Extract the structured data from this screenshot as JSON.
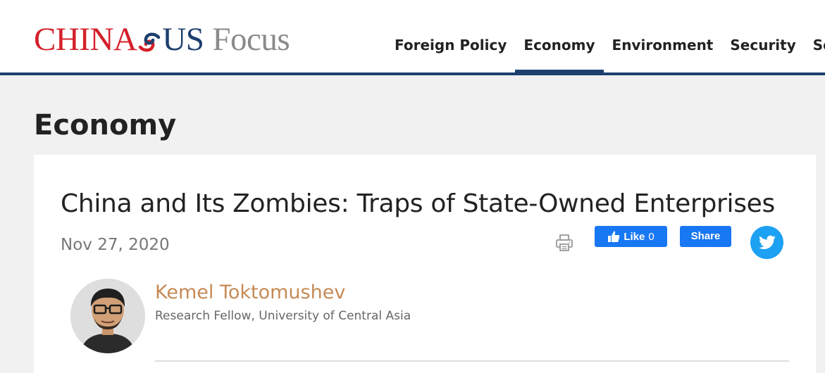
{
  "header": {
    "logo": {
      "part1": "CHINA",
      "part2": "US",
      "part3": "Focus"
    },
    "nav": [
      {
        "label": "Foreign Policy",
        "active": false
      },
      {
        "label": "Economy",
        "active": true
      },
      {
        "label": "Environment",
        "active": false
      },
      {
        "label": "Security",
        "active": false
      },
      {
        "label": "Socie",
        "active": false
      }
    ]
  },
  "section": {
    "title": "Economy"
  },
  "article": {
    "title": "China and Its Zombies: Traps of State-Owned Enterprises",
    "date": "Nov 27, 2020",
    "share": {
      "print_icon": "print-icon",
      "like_label": "Like",
      "like_count": "0",
      "share_label": "Share",
      "twitter_icon": "twitter-icon"
    },
    "author": {
      "name": "Kemel Toktomushev",
      "role": "Research Fellow, University of Central Asia"
    }
  },
  "colors": {
    "brand_red": "#d4202a",
    "brand_navy": "#1d3f6e",
    "facebook_blue": "#1877f2",
    "twitter_blue": "#1da1f2",
    "author_link": "#c68a55"
  }
}
